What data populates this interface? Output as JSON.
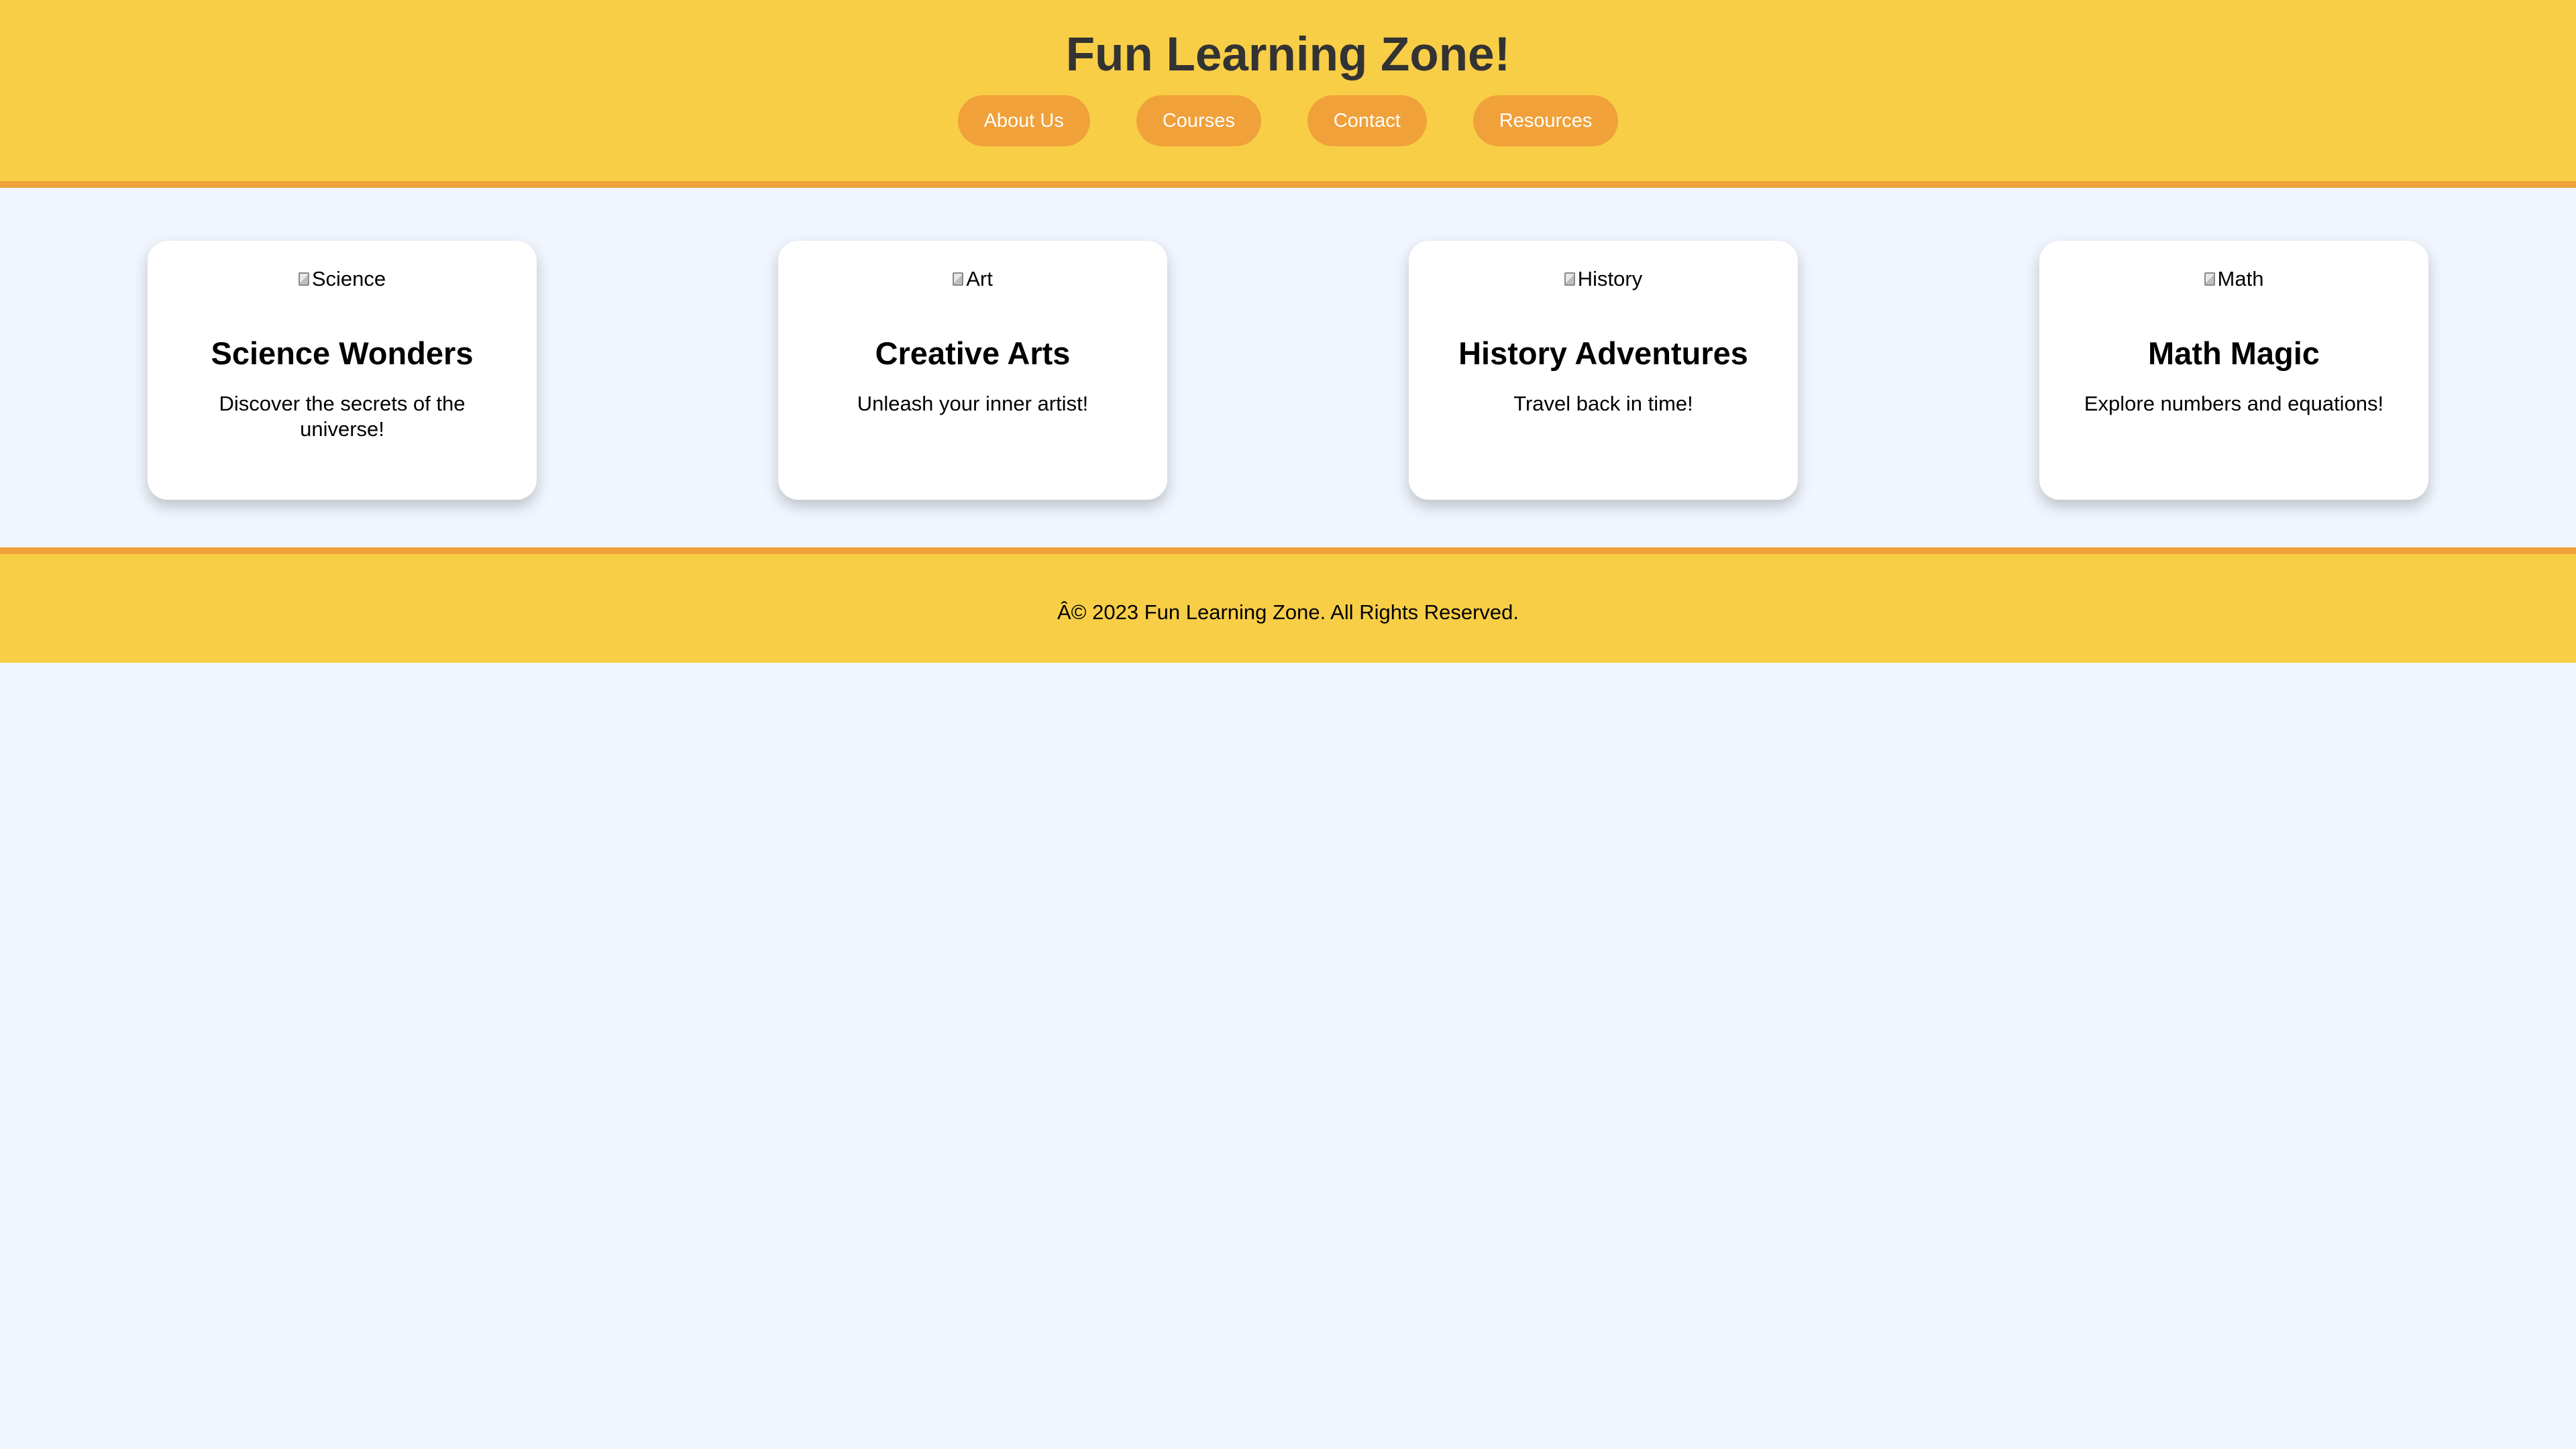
{
  "header": {
    "title": "Fun Learning Zone!",
    "nav": [
      {
        "label": "About Us"
      },
      {
        "label": "Courses"
      },
      {
        "label": "Contact"
      },
      {
        "label": "Resources"
      }
    ]
  },
  "cards": [
    {
      "image_alt": "Science",
      "title": "Science Wonders",
      "description": "Discover the secrets of the universe!"
    },
    {
      "image_alt": "Art",
      "title": "Creative Arts",
      "description": "Unleash your inner artist!"
    },
    {
      "image_alt": "History",
      "title": "History Adventures",
      "description": "Travel back in time!"
    },
    {
      "image_alt": "Math",
      "title": "Math Magic",
      "description": "Explore numbers and equations!"
    }
  ],
  "footer": {
    "text": "Â© 2023 Fun Learning Zone. All Rights Reserved."
  },
  "colors": {
    "header_bg": "#f8ce47",
    "accent": "#f0a13a",
    "page_bg": "#f1f6fe",
    "title_text": "#333333",
    "card_bg": "#ffffff"
  }
}
